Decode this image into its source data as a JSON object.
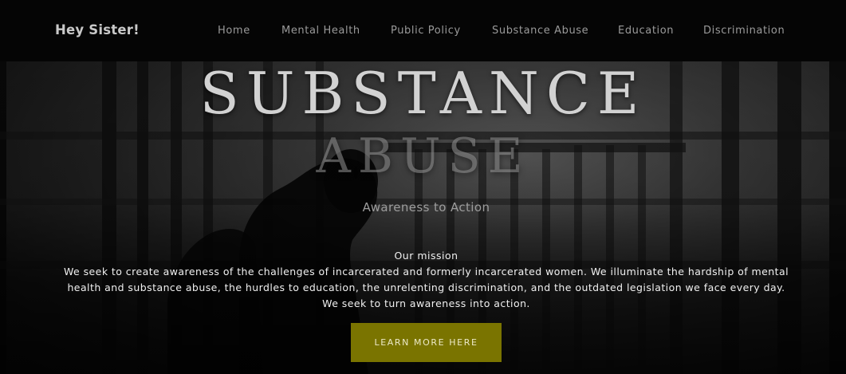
{
  "header": {
    "brand": "Hey Sister!",
    "nav": [
      {
        "label": "Home"
      },
      {
        "label": "Mental Health"
      },
      {
        "label": "Public Policy"
      },
      {
        "label": "Substance Abuse"
      },
      {
        "label": "Education"
      },
      {
        "label": "Discrimination"
      }
    ]
  },
  "hero": {
    "title_line1": "SUBSTANCE",
    "title_line2": "ABUSE",
    "subtitle": "Awareness to Action",
    "mission_heading": "Our mission",
    "mission_lines": [
      "We seek to create awareness of the challenges of incarcerated and formerly incarcerated women. We illuminate the hardship of mental",
      "health and substance abuse, the hurdles to education, the unrelenting discrimination, and the outdated legislation we face every day.",
      "We seek to turn awareness into action."
    ],
    "cta_label": "LEARN MORE HERE"
  },
  "colors": {
    "navbar_bg": "#050505",
    "cta_bg": "#7a7400",
    "cta_text": "#ece9c8"
  }
}
